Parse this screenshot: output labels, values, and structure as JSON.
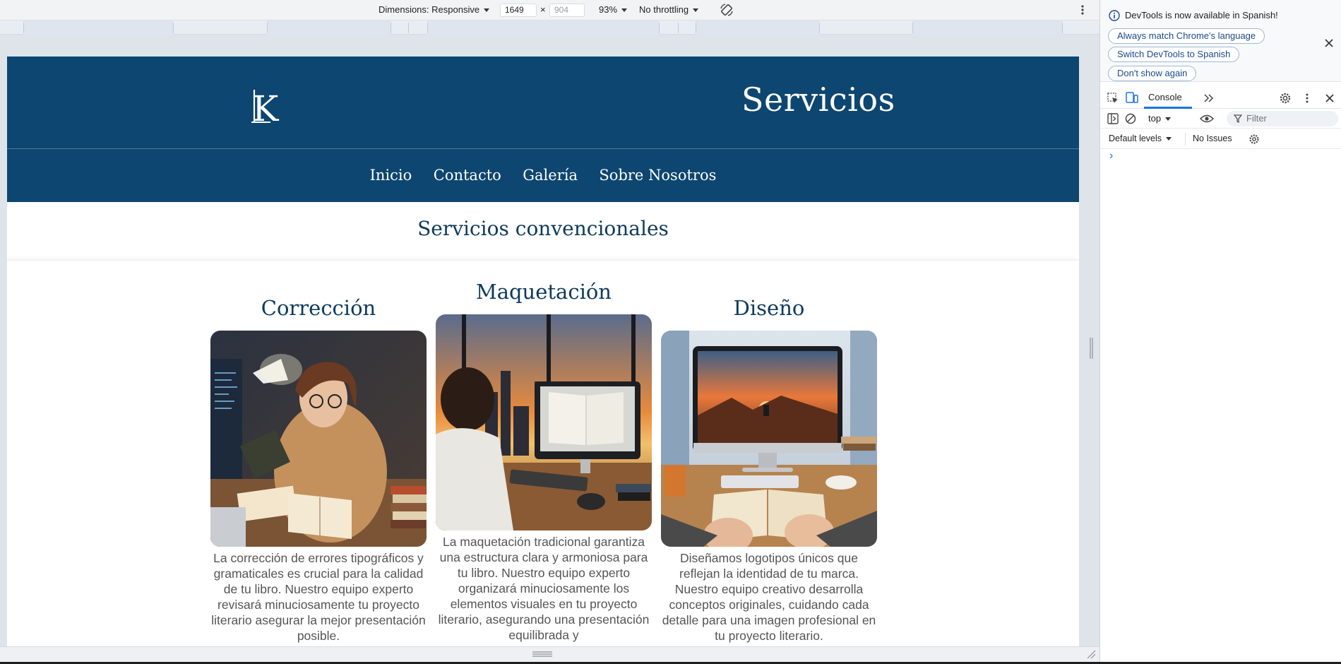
{
  "device_toolbar": {
    "dimensions_label": "Dimensions: Responsive",
    "width_value": "1649",
    "times": "×",
    "height_placeholder": "904",
    "zoom": "93%",
    "throttling": "No throttling"
  },
  "site": {
    "logo_text": "K",
    "title": "Servicios",
    "nav": [
      "Inicio",
      "Contacto",
      "Galería",
      "Sobre Nosotros"
    ],
    "section_title": "Servicios convencionales",
    "cards": [
      {
        "title": "Corrección",
        "text": "La corrección de errores tipográficos y gramaticales es crucial para la calidad de tu libro. Nuestro equipo experto revisará minuciosamente tu proyecto literario asegurar la mejor presentación posible."
      },
      {
        "title": "Maquetación",
        "text": "La maquetación tradicional garantiza una estructura clara y armoniosa para tu libro. Nuestro equipo experto organizará minuciosamente los elementos visuales en tu proyecto literario, asegurando una presentación equilibrada y"
      },
      {
        "title": "Diseño",
        "text": "Diseñamos logotipos únicos que reflejan la identidad de tu marca. Nuestro equipo creativo desarrolla conceptos originales, cuidando cada detalle para una imagen profesional en tu proyecto literario."
      }
    ]
  },
  "devtools": {
    "banner_text": "DevTools is now available in Spanish!",
    "buttons": [
      "Always match Chrome's language",
      "Switch DevTools to Spanish",
      "Don't show again"
    ],
    "tab_console": "Console",
    "context": "top",
    "filter_placeholder": "Filter",
    "levels": "Default levels",
    "issues": "No Issues",
    "prompt": "›"
  },
  "colors": {
    "header_bg": "#0d4670",
    "heading": "#0d3a5c",
    "body_text": "#555555",
    "link_blue": "#1a4a8c"
  }
}
